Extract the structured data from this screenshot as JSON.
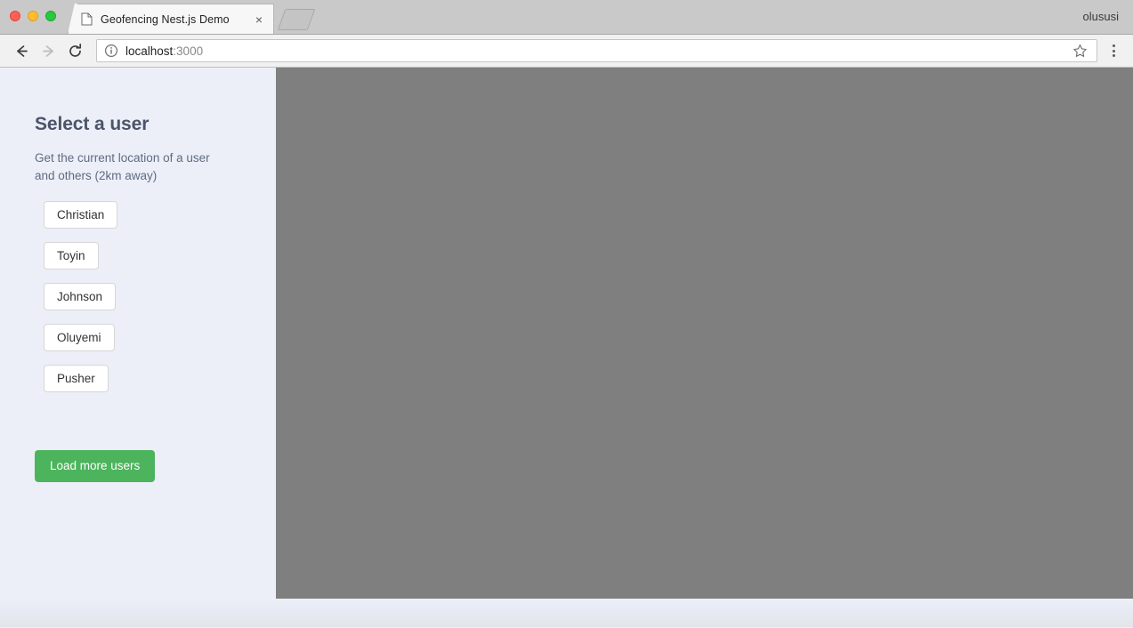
{
  "browser": {
    "profile_name": "olususi",
    "tab": {
      "title": "Geofencing Nest.js Demo",
      "favicon": "page-icon",
      "close_label": "×"
    },
    "newtab_label": "",
    "toolbar": {
      "back_icon": "back-arrow-icon",
      "forward_icon": "forward-arrow-icon",
      "reload_icon": "reload-icon",
      "info_icon": "site-info-icon",
      "url_host": "localhost",
      "url_port": ":3000",
      "url_full": "localhost:3000",
      "star_icon": "bookmark-star-icon",
      "menu_icon": "three-dot-menu-icon"
    }
  },
  "page": {
    "title": "Select a user",
    "subtitle": "Get the current location of a user and others (2km away)",
    "users": [
      {
        "name": "Christian"
      },
      {
        "name": "Toyin"
      },
      {
        "name": "Johnson"
      },
      {
        "name": "Oluyemi"
      },
      {
        "name": "Pusher"
      }
    ],
    "load_more_label": "Load more users",
    "map_placeholder": ""
  },
  "colors": {
    "sidebar_bg": "#eceff8",
    "map_bg": "#7f7f7f",
    "accent_green": "#4CB45C",
    "title_color": "#4b5468",
    "subtitle_color": "#606b80",
    "tabstrip_bg": "#c9c9c9",
    "toolbar_bg": "#f1f1f1"
  }
}
